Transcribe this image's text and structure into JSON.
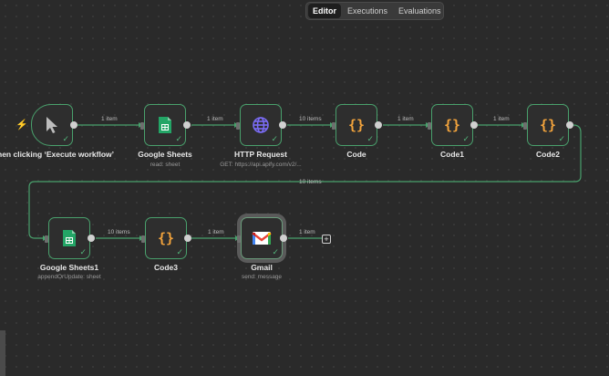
{
  "tabs": [
    {
      "label": "Editor",
      "active": true
    },
    {
      "label": "Executions",
      "active": false
    },
    {
      "label": "Evaluations",
      "active": false
    }
  ],
  "nodes": {
    "trigger": {
      "label": "When clicking ‘Execute workflow’",
      "icon": "cursor-icon",
      "status": "success"
    },
    "sheets": {
      "label": "Google Sheets",
      "subtitle": "read: sheet",
      "icon": "google-sheets-icon",
      "status": "success"
    },
    "http": {
      "label": "HTTP Request",
      "subtitle": "GET: https://api.apify.com/v2/...",
      "icon": "globe-icon",
      "status": "success"
    },
    "code": {
      "label": "Code",
      "icon": "braces-icon",
      "icon_text": "{}",
      "status": "success"
    },
    "code1": {
      "label": "Code1",
      "icon": "braces-icon",
      "icon_text": "{}",
      "status": "success"
    },
    "code2": {
      "label": "Code2",
      "icon": "braces-icon",
      "icon_text": "{}",
      "status": "success"
    },
    "sheets1": {
      "label": "Google Sheets1",
      "subtitle": "appendOrUpdate: sheet",
      "icon": "google-sheets-icon",
      "status": "success"
    },
    "code3": {
      "label": "Code3",
      "icon": "braces-icon",
      "icon_text": "{}",
      "status": "success"
    },
    "gmail": {
      "label": "Gmail",
      "subtitle": "send: message",
      "icon": "gmail-icon",
      "status": "success"
    }
  },
  "edges": {
    "e1": "1 item",
    "e2": "1 item",
    "e3": "10 items",
    "e4": "1 item",
    "e5": "1 item",
    "e6": "10 items",
    "e7": "10 items",
    "e8": "1 item",
    "e9": "1 item"
  },
  "colors": {
    "canvas": "#2a2a2a",
    "node_border": "#49a06c",
    "edge": "#49a06c",
    "code_icon": "#f2a33c",
    "trigger_bolt": "#ff6d4a",
    "http_icon": "#7b6cf6"
  }
}
